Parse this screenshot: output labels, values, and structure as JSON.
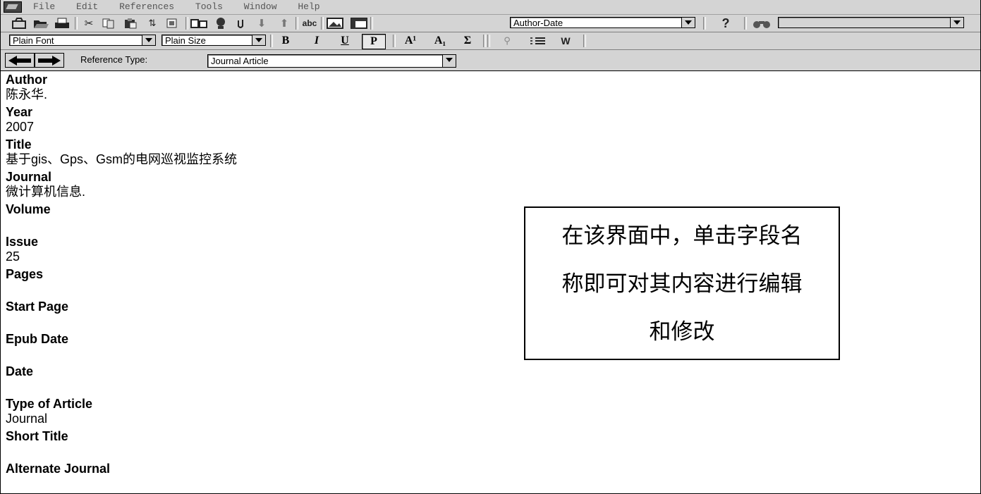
{
  "menubar": {
    "items": [
      "File",
      "Edit",
      "References",
      "Tools",
      "Window",
      "Help"
    ]
  },
  "toolbar": {
    "style": "Author-Date",
    "font": "Plain Font",
    "size": "Plain Size",
    "format_buttons": [
      "B",
      "I",
      "U",
      "P",
      "A¹",
      "A₁",
      "Σ"
    ],
    "help_label": "?"
  },
  "reference": {
    "type_label": "Reference Type:",
    "type_value": "Journal Article"
  },
  "fields": [
    {
      "name": "Author",
      "value": "陈永华."
    },
    {
      "name": "Year",
      "value": "2007"
    },
    {
      "name": "Title",
      "value": "基于gis、Gps、Gsm的电网巡视监控系统"
    },
    {
      "name": "Journal",
      "value": "微计算机信息."
    },
    {
      "name": "Volume",
      "value": ""
    },
    {
      "name": "Issue",
      "value": "25"
    },
    {
      "name": "Pages",
      "value": ""
    },
    {
      "name": "Start Page",
      "value": ""
    },
    {
      "name": "Epub Date",
      "value": ""
    },
    {
      "name": "Date",
      "value": ""
    },
    {
      "name": "Type of Article",
      "value": "Journal"
    },
    {
      "name": "Short Title",
      "value": ""
    },
    {
      "name": "Alternate Journal",
      "value": ""
    }
  ],
  "callout": {
    "lines": [
      "在该界面中，单击字段名",
      "称即可对其内容进行编辑",
      "和修改"
    ]
  }
}
